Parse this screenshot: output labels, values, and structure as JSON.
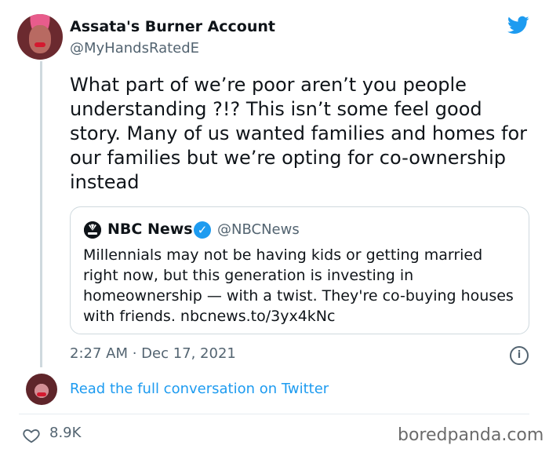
{
  "author": {
    "name": "Assata's Burner Account",
    "handle": "@MyHandsRatedE",
    "avatar_icon": "profile-photo-icon"
  },
  "tweet": {
    "text": "What part of we’re poor aren’t you people understanding ?!? This isn’t some feel good story. Many of us wanted families and homes for our families but we’re opting for co-ownership instead",
    "timestamp": "2:27 AM · Dec 17, 2021",
    "likes": "8.9K"
  },
  "quote": {
    "name": "NBC News",
    "handle": "@NBCNews",
    "text": "Millennials may not be having kids or getting married right now, but this generation is investing in homeownership — with a twist. They're co-buying houses with friends. nbcnews.to/3yx4kNc",
    "logo_icon": "nbc-peacock-icon",
    "verified_icon": "verified-badge-icon"
  },
  "conversation": {
    "link_text": "Read the full conversation on Twitter"
  },
  "icons": {
    "brand": "twitter-bird-icon",
    "info": "info-icon",
    "like": "heart-icon"
  },
  "colors": {
    "accent": "#1d9bf0",
    "text": "#0f1419",
    "muted": "#536471",
    "border": "#cfd9de"
  },
  "watermark": "boredpanda.com"
}
